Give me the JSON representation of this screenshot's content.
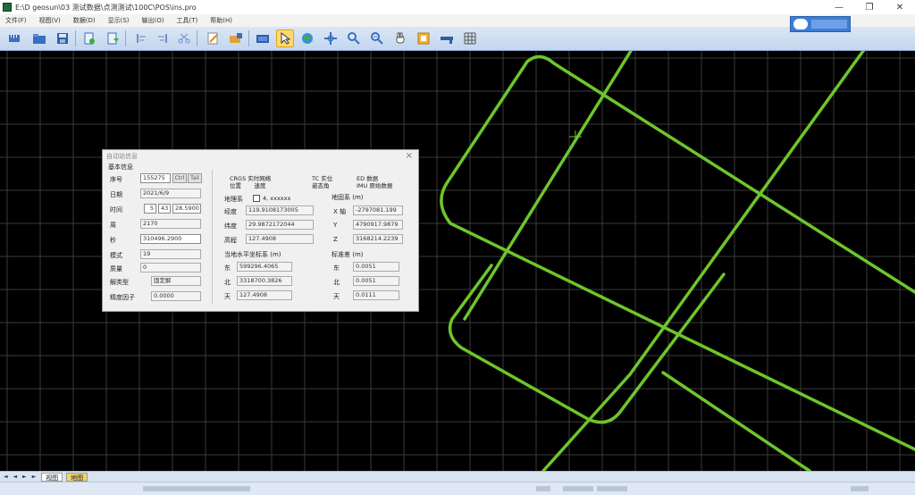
{
  "window": {
    "title": "E:\\D geosun\\03 测试数据\\点测测试\\100C\\POS\\ins.pro",
    "minimize_glyph": "—",
    "maximize_glyph": "❐",
    "close_glyph": "✕"
  },
  "menu": [
    "文件(F)",
    "视图(V)",
    "数据(D)",
    "显示(S)",
    "输出(O)",
    "工具(T)",
    "帮助(H)"
  ],
  "toolbar": {
    "buttons": [
      "ruler-icon",
      "open-folder-icon",
      "save-icon",
      "new-page-icon",
      "export-icon",
      "align-left-icon",
      "align-right-icon",
      "scissors-icon",
      "edit-icon",
      "folder-add-icon",
      "layer-icon",
      "select-arrow-icon",
      "globe-icon",
      "crosshair-icon",
      "zoom-in-icon",
      "zoom-out-icon",
      "pan-hand-icon",
      "frame-icon",
      "measure-icon",
      "grid-icon"
    ],
    "active_index": 11
  },
  "dialog": {
    "title": "自动站信息",
    "close_glyph": "×",
    "basic_section": "基本信息",
    "labels": {
      "seq": "序号",
      "date": "日期",
      "time": "时间",
      "week": "周",
      "second": "秒",
      "mode": "模式",
      "quality": "质量",
      "solution": "解类型",
      "precision": "精度因子"
    },
    "values": {
      "seq": "155275",
      "date": "2021/6/9",
      "time_h": "5",
      "time_m": "43",
      "time_s": "28.5900",
      "week": "2170",
      "second": "310496.2900",
      "mode": "19",
      "quality": "0",
      "solution": "固定解",
      "precision": "0.0000"
    },
    "seq_buttons": [
      "Ctrl",
      "Tail"
    ],
    "headers": {
      "cgcs": "CRGS 实时网络\n位置       速度",
      "tc": "TC 实位\n姿态角",
      "ed": "ED 数据\nIMU 原始数据"
    },
    "geodetic_label": "地理系",
    "geodetic_check": "4, xxxxxx",
    "geocentric_label": "地固系 (m)",
    "geo": {
      "lon_label": "经度",
      "lon": "119.9108173005",
      "lat_label": "纬度",
      "lat": "29.9872172044",
      "h_label": "高程",
      "h": "127.4908"
    },
    "ecef": {
      "x_label": "X 轴",
      "x": "-2797081.199",
      "y_label": "Y",
      "y": "4790917.9879",
      "z_label": "Z",
      "z": "3168214.2239"
    },
    "enu_section": "当地水平坐标系 (m)",
    "enu": {
      "e_label": "东",
      "e": "599296.4065",
      "n_label": "北",
      "n": "3318700.3826",
      "u_label": "天",
      "u": "127.4908"
    },
    "std_section": "标准差 (m)",
    "std": {
      "e_label": "东",
      "e": "0.0051",
      "n_label": "北",
      "n": "0.0051",
      "u_label": "天",
      "u": "0.0111"
    }
  },
  "tabs": {
    "arrows": "◄ ◄ ► ►",
    "items": [
      "视图",
      "地图"
    ]
  }
}
